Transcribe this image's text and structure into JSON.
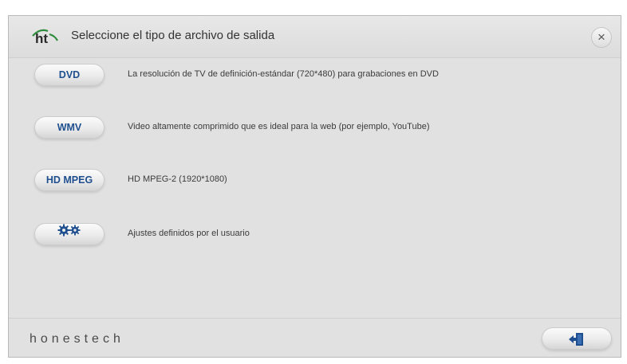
{
  "dialog": {
    "title": "Seleccione el tipo de archivo de salida",
    "close_label": "×",
    "brand": "honestech",
    "logo_text": "ht"
  },
  "options": [
    {
      "button_label": "DVD",
      "description": "La resolución de TV de definición-estándar (720*480) para grabaciones en DVD"
    },
    {
      "button_label": "WMV",
      "description": "Video altamente comprimido que es ideal para la web (por ejemplo, YouTube)"
    },
    {
      "button_label": "HD MPEG",
      "description": "HD MPEG-2 (1920*1080)"
    },
    {
      "button_icon": "gears-icon",
      "description": "Ajustes definidos por el usuario"
    }
  ],
  "footer": {
    "exit_icon": "exit-door-icon"
  },
  "colors": {
    "button_text": "#1f4f8f",
    "logo_green": "#2e8b3c",
    "background": "#e1e1e1"
  }
}
